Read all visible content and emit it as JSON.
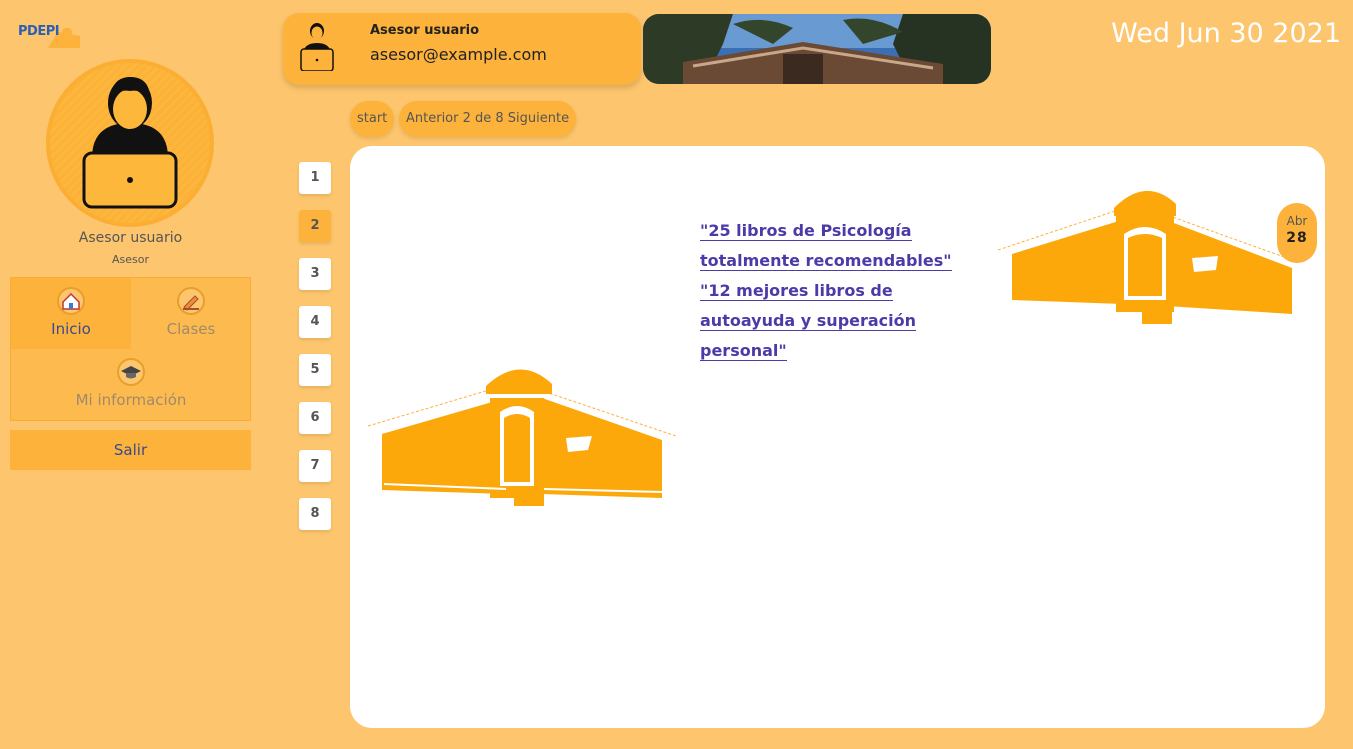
{
  "sidebar": {
    "logo_text": "PDEPI",
    "user_name": "Asesor usuario",
    "user_role": "Asesor",
    "nav": [
      {
        "label": "Inicio",
        "icon": "home-icon",
        "active": true
      },
      {
        "label": "Clases",
        "icon": "pencil-icon",
        "active": false
      },
      {
        "label": "Mi información",
        "icon": "graduation-cap-icon",
        "active": false
      }
    ],
    "logout_label": "Salir"
  },
  "header": {
    "user_name": "Asesor usuario",
    "user_email": "asesor@example.com",
    "date": "Wed Jun 30 2021"
  },
  "pagination": {
    "start_label": "start",
    "nav_label": "Anterior 2 de 8 Siguiente",
    "pages": [
      "1",
      "2",
      "3",
      "4",
      "5",
      "6",
      "7",
      "8"
    ],
    "current": "2"
  },
  "post": {
    "links": [
      "\"25 libros de Psicología totalmente recomendables\"",
      "\"12 mejores libros de autoayuda y superación personal\""
    ],
    "date_month": "Abr",
    "date_day": "28"
  },
  "colors": {
    "background": "#fdc56d",
    "accent": "#fcb23b",
    "link": "#4b3ba8"
  }
}
